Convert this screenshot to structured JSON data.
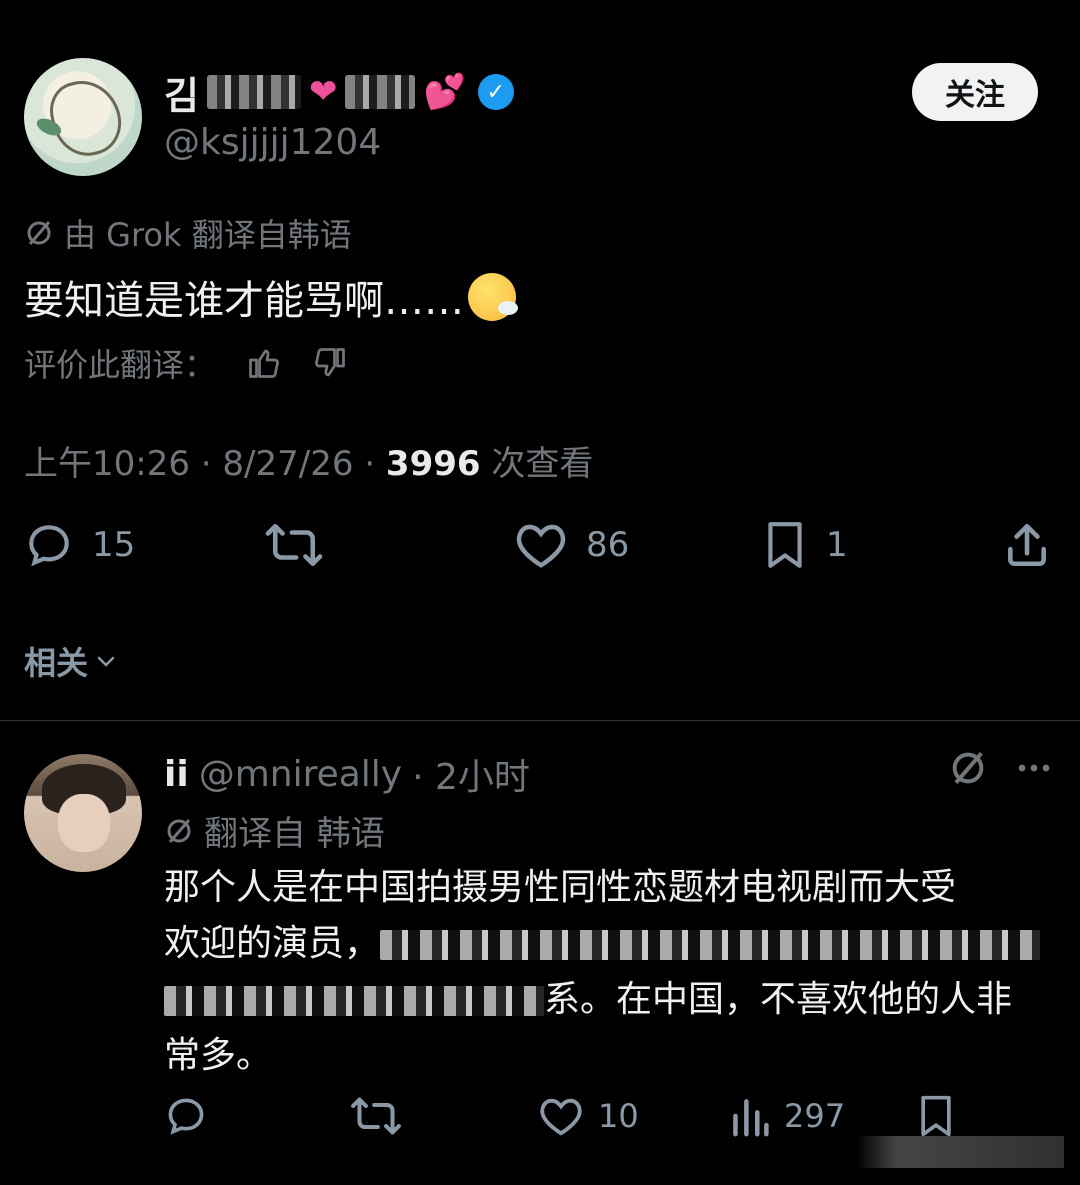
{
  "tweet": {
    "display_name_visible": "김",
    "handle": "@ksjjjjj1204",
    "follow_label": "关注",
    "translation_note": "由 Grok 翻译自韩语",
    "text": "要知道是谁才能骂啊……",
    "rate_label": "评价此翻译：",
    "time": "上午10:26 · 8/27/26 · ",
    "views_count": "3996",
    "views_label": " 次查看",
    "actions": {
      "replies": "15",
      "likes": "86",
      "bookmarks": "1"
    },
    "related_label": "相关"
  },
  "reply": {
    "display_name": "ii",
    "handle": "@mnireally",
    "time": "· 2小时",
    "translation_note": "翻译自 韩语",
    "text_line1": "那个人是在中国拍摄男性同性恋题材电视剧而大受",
    "text_line2_start": "欢迎的演员，",
    "text_line3_end": "系。在中国，不喜欢他的人非",
    "text_line4": "常多。",
    "actions": {
      "likes": "10",
      "views": "297"
    }
  },
  "colors": {
    "background": "#000000",
    "text": "#e7e9ea",
    "muted": "#71767b",
    "verified": "#1d9bf0",
    "heart_pink": "#f0509a"
  }
}
